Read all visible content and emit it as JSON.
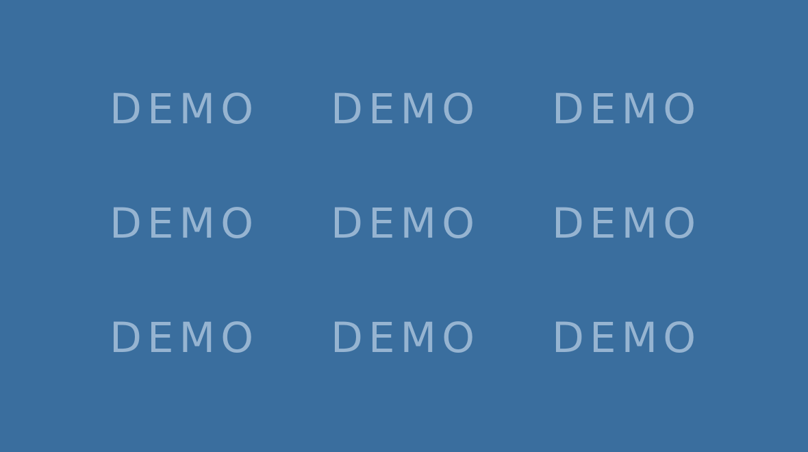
{
  "background": {
    "color": "#3a6e9e"
  },
  "watermark": {
    "color": "#96b4d1",
    "rows": [
      [
        "DEMO",
        "DEMO",
        "DEMO"
      ],
      [
        "DEMO",
        "DEMO",
        "DEMO"
      ],
      [
        "DEMO",
        "DEMO",
        "DEMO"
      ]
    ]
  }
}
